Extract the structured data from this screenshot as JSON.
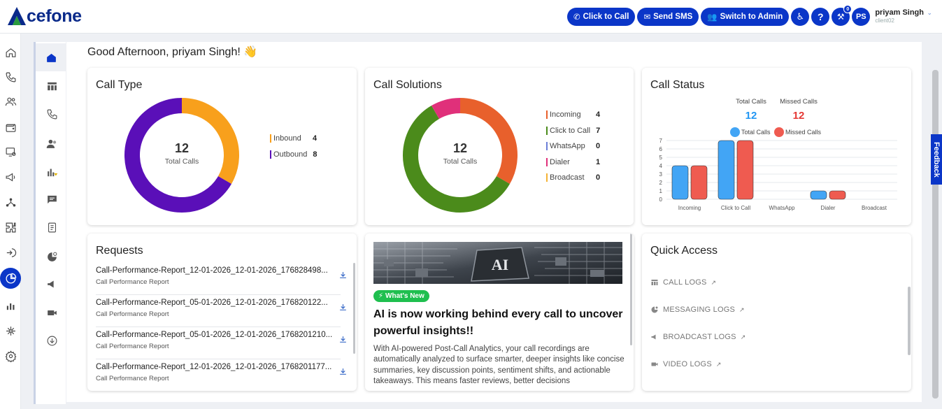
{
  "brand": {
    "logo_a": "A",
    "logo_rest": "cefone"
  },
  "topbar": {
    "click_to_call": "Click to Call",
    "send_sms": "Send SMS",
    "switch_admin": "Switch to Admin",
    "badge": "0",
    "avatar": "PS",
    "user_name": "priyam Singh",
    "user_sub": "client02"
  },
  "greeting": "Good Afternoon, priyam Singh! 👋",
  "call_type": {
    "title": "Call Type",
    "total": "12",
    "total_label": "Total Calls",
    "legend": [
      {
        "label": "Inbound",
        "value": "4",
        "color": "#f8a01c"
      },
      {
        "label": "Outbound",
        "value": "8",
        "color": "#5a0fb8"
      }
    ]
  },
  "call_solutions": {
    "title": "Call Solutions",
    "total": "12",
    "total_label": "Total Calls",
    "legend": [
      {
        "label": "Incoming",
        "value": "4",
        "color": "#e8602c"
      },
      {
        "label": "Click to Call",
        "value": "7",
        "color": "#4b8b1b"
      },
      {
        "label": "WhatsApp",
        "value": "0",
        "color": "#6b7fd8"
      },
      {
        "label": "Dialer",
        "value": "1",
        "color": "#e0307a"
      },
      {
        "label": "Broadcast",
        "value": "0",
        "color": "#f5b335"
      }
    ]
  },
  "call_status": {
    "title": "Call Status",
    "total_label": "Total Calls",
    "missed_label": "Missed Calls",
    "total_value": "12",
    "missed_value": "12",
    "legend_total": "Total Calls",
    "legend_missed": "Missed Calls",
    "total_color": "#42a5f5",
    "missed_color": "#ef5b50"
  },
  "chart_data": {
    "type": "bar",
    "categories": [
      "Incoming",
      "Click to Call",
      "WhatsApp",
      "Dialer",
      "Broadcast"
    ],
    "series": [
      {
        "name": "Total Calls",
        "values": [
          4,
          7,
          0,
          1,
          0
        ]
      },
      {
        "name": "Missed Calls",
        "values": [
          4,
          7,
          0,
          1,
          0
        ]
      }
    ],
    "ylim": [
      0,
      7
    ],
    "yticks": [
      "0",
      "1",
      "2",
      "3",
      "4",
      "5",
      "6",
      "7"
    ],
    "grid": true,
    "legend": "top"
  },
  "requests": {
    "title": "Requests",
    "items": [
      {
        "name": "Call-Performance-Report_12-01-2026_12-01-2026_176828498...",
        "sub": "Call Performance Report"
      },
      {
        "name": "Call-Performance-Report_05-01-2026_12-01-2026_176820122...",
        "sub": "Call Performance Report"
      },
      {
        "name": "Call-Performance-Report_05-01-2026_12-01-2026_1768201210...",
        "sub": "Call Performance Report"
      },
      {
        "name": "Call-Performance-Report_12-01-2026_12-01-2026_1768201177...",
        "sub": "Call Performance Report"
      }
    ]
  },
  "news": {
    "badge": "What's New",
    "chip": "AI",
    "headline": "AI is now working behind every call to uncover powerful insights!!",
    "body": "With AI-powered Post-Call Analytics, your call recordings are automatically analyzed to surface smarter, deeper insights like concise summaries, key discussion points, sentiment shifts, and actionable takeaways. This means faster reviews, better decisions"
  },
  "quick_access": {
    "title": "Quick Access",
    "items": [
      {
        "label": "CALL LOGS"
      },
      {
        "label": "MESSAGING LOGS"
      },
      {
        "label": "BROADCAST LOGS"
      },
      {
        "label": "VIDEO LOGS"
      }
    ]
  },
  "feedback": "Feedback"
}
